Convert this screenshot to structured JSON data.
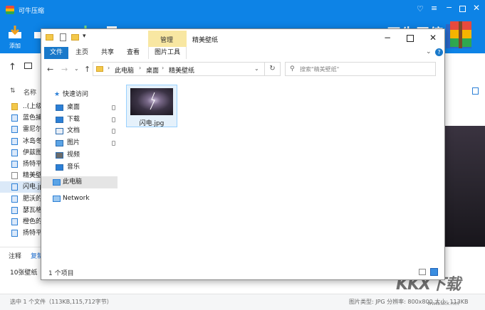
{
  "app": {
    "title": "可牛压缩",
    "brand_text": "可牛压缩",
    "colors": {
      "primary": "#0d83e6",
      "selection": "#dbe9f8",
      "ribbon_active": "#1979ca",
      "tab_highlight": "#f8e7a2"
    },
    "toolbar": {
      "add_label": "添加",
      "second_label": ""
    },
    "list": {
      "header_name": "名称",
      "rows": [
        {
          "name": "..(上级目录)",
          "icon": "folder-icon",
          "selected": false
        },
        {
          "name": "蓝色捕",
          "icon": "image-file-icon",
          "selected": false
        },
        {
          "name": "雷尼尔",
          "icon": "image-file-icon",
          "selected": false
        },
        {
          "name": "冰岛冬",
          "icon": "image-file-icon",
          "selected": false
        },
        {
          "name": "伊兹图",
          "icon": "image-file-icon",
          "selected": false
        },
        {
          "name": "扬特平",
          "icon": "image-file-icon",
          "selected": false
        },
        {
          "name": "精美壁",
          "icon": "text-file-icon",
          "selected": false
        },
        {
          "name": "闪电.jpg",
          "icon": "image-file-icon",
          "selected": true
        },
        {
          "name": "肥沃的",
          "icon": "image-file-icon",
          "selected": false
        },
        {
          "name": "瑟瓦格",
          "icon": "image-file-icon",
          "selected": false
        },
        {
          "name": "橙色的",
          "icon": "image-file-icon",
          "selected": false
        },
        {
          "name": "扬特平",
          "icon": "image-file-icon",
          "selected": false
        }
      ]
    },
    "comment": {
      "label": "注释",
      "copy_label": "复制"
    },
    "bottom": {
      "count_text": "10张壁纸"
    },
    "status": {
      "left": "选中 1 个文件（113KB,115,712字节）",
      "right": "图片类型: JPG  分辨率: 800x800  大小: 113KB"
    },
    "preview": {
      "view_label": "预览"
    },
    "watermark": "KKX下载",
    "watermark_url": "www.kkx.net"
  },
  "explorer": {
    "title": "精美壁纸",
    "manage_tab": "管理",
    "quick_access_dropdown": "▾",
    "ribbon": {
      "tabs": [
        "文件",
        "主页",
        "共享",
        "查看"
      ],
      "context_tab": "图片工具"
    },
    "address": {
      "segments": [
        "此电脑",
        "桌面",
        "精美壁纸"
      ],
      "search_placeholder": "搜索\"精美壁纸\""
    },
    "nav": {
      "quick_access": "快速访问",
      "items": [
        {
          "label": "桌面",
          "icon": "desktop-icon",
          "pinned": true
        },
        {
          "label": "下载",
          "icon": "download-icon",
          "pinned": true
        },
        {
          "label": "文档",
          "icon": "document-icon",
          "pinned": true
        },
        {
          "label": "图片",
          "icon": "picture-icon",
          "pinned": true
        },
        {
          "label": "视频",
          "icon": "video-icon",
          "pinned": false
        },
        {
          "label": "音乐",
          "icon": "music-icon",
          "pinned": false
        }
      ],
      "this_pc": "此电脑",
      "network": "Network"
    },
    "content": {
      "files": [
        {
          "name": "闪电.jpg",
          "icon": "lightning-thumbnail"
        }
      ]
    },
    "status": {
      "item_count": "1 个项目"
    }
  }
}
